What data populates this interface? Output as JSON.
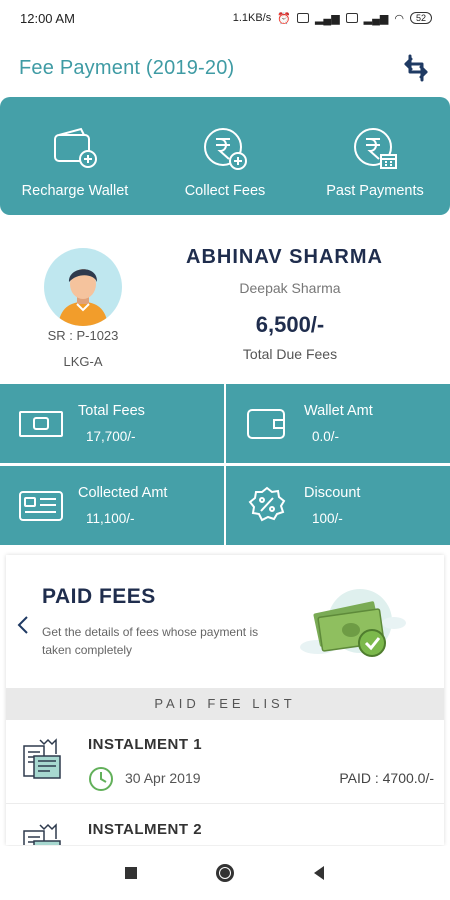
{
  "status_bar": {
    "time": "12:00 AM",
    "network_speed": "1.1KB/s",
    "battery": "52"
  },
  "header": {
    "title": "Fee Payment (2019-20)",
    "swap_icon": "swap-arrows-icon"
  },
  "actions": [
    {
      "label": "Recharge Wallet",
      "icon": "wallet-add-icon"
    },
    {
      "label": "Collect Fees",
      "icon": "rupee-add-icon"
    },
    {
      "label": "Past Payments",
      "icon": "rupee-calendar-icon"
    }
  ],
  "student": {
    "name": "ABHINAV SHARMA",
    "parent": "Deepak Sharma",
    "sr": "SR : P-1023",
    "class": "LKG-A",
    "due_amount": "6,500/-",
    "due_label": "Total Due Fees"
  },
  "stats": [
    {
      "label": "Total Fees",
      "value": "17,700/-",
      "icon": "cash-note-icon"
    },
    {
      "label": "Wallet Amt",
      "value": "0.0/-",
      "icon": "wallet-icon"
    },
    {
      "label": "Collected Amt",
      "value": "11,100/-",
      "icon": "id-card-icon"
    },
    {
      "label": "Discount",
      "value": "100/-",
      "icon": "percent-badge-icon"
    }
  ],
  "paid_fees": {
    "title": "PAID FEES",
    "subtitle": "Get the details of fees whose payment is taken completely",
    "list_header": "PAID FEE LIST"
  },
  "instalments": [
    {
      "title": "INSTALMENT 1",
      "date": "30 Apr 2019",
      "status": "PAID : 4700.0/-"
    },
    {
      "title": "INSTALMENT 2",
      "date": "",
      "status": ""
    }
  ],
  "colors": {
    "teal": "#45a0a8",
    "title_teal": "#3f9ba4",
    "navy": "#1f2d4d"
  }
}
